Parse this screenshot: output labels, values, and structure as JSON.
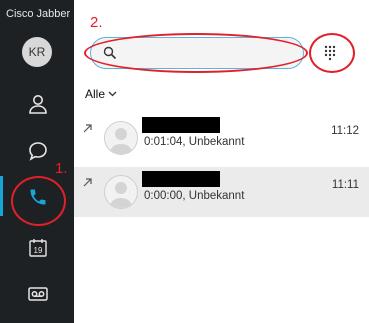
{
  "app": {
    "title": "Cisco Jabber"
  },
  "user": {
    "initials": "KR"
  },
  "sidebar": {
    "items": [
      {
        "name": "contacts",
        "icon": "person-icon"
      },
      {
        "name": "chats",
        "icon": "chat-bubble-icon"
      },
      {
        "name": "calls",
        "icon": "phone-icon",
        "active": true
      },
      {
        "name": "meetings",
        "icon": "calendar-icon",
        "calendar_day": "19"
      },
      {
        "name": "voicemail",
        "icon": "voicemail-icon"
      }
    ]
  },
  "annotations": {
    "step1": "1.",
    "step2": "2."
  },
  "search": {
    "value": "",
    "placeholder": ""
  },
  "filter": {
    "label": "Alle"
  },
  "calls": [
    {
      "detail": "0:01:04, Unbekannt",
      "time": "11:12",
      "selected": false
    },
    {
      "detail": "0:00:00, Unbekannt",
      "time": "11:11",
      "selected": true
    }
  ],
  "colors": {
    "accent": "#17a6d8",
    "annotation": "#e2202a",
    "sidebar": "#1e2124"
  }
}
